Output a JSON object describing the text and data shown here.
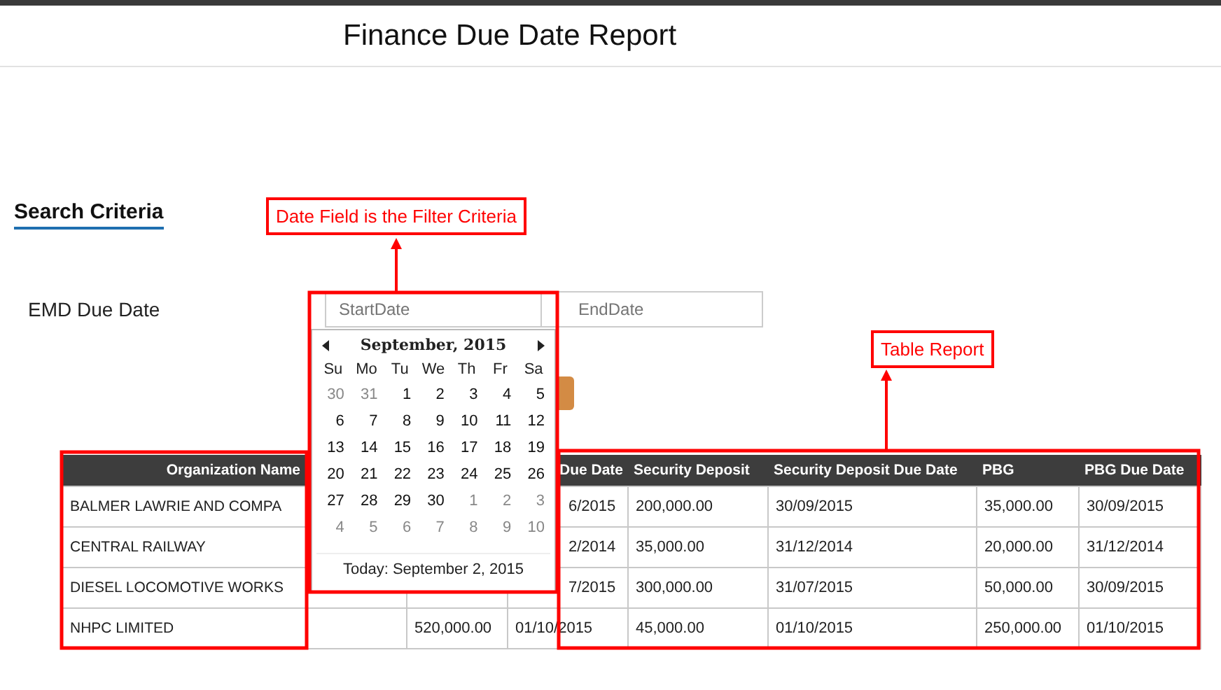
{
  "page": {
    "title": "Finance Due Date Report"
  },
  "search_criteria": {
    "heading": "Search Criteria",
    "field_label": "EMD Due Date",
    "start": {
      "placeholder": "StartDate"
    },
    "end": {
      "placeholder": "EndDate"
    }
  },
  "date_picker": {
    "month": "September, 2015",
    "weekdays": [
      "Su",
      "Mo",
      "Tu",
      "We",
      "Th",
      "Fr",
      "Sa"
    ],
    "weeks": [
      [
        {
          "day": "30",
          "other_month": true
        },
        {
          "day": "31",
          "other_month": true
        },
        {
          "day": "1",
          "other_month": false
        },
        {
          "day": "2",
          "other_month": false
        },
        {
          "day": "3",
          "other_month": false
        },
        {
          "day": "4",
          "other_month": false
        },
        {
          "day": "5",
          "other_month": false
        }
      ],
      [
        {
          "day": "6",
          "other_month": false
        },
        {
          "day": "7",
          "other_month": false
        },
        {
          "day": "8",
          "other_month": false
        },
        {
          "day": "9",
          "other_month": false
        },
        {
          "day": "10",
          "other_month": false
        },
        {
          "day": "11",
          "other_month": false
        },
        {
          "day": "12",
          "other_month": false
        }
      ],
      [
        {
          "day": "13",
          "other_month": false
        },
        {
          "day": "14",
          "other_month": false
        },
        {
          "day": "15",
          "other_month": false
        },
        {
          "day": "16",
          "other_month": false
        },
        {
          "day": "17",
          "other_month": false
        },
        {
          "day": "18",
          "other_month": false
        },
        {
          "day": "19",
          "other_month": false
        }
      ],
      [
        {
          "day": "20",
          "other_month": false
        },
        {
          "day": "21",
          "other_month": false
        },
        {
          "day": "22",
          "other_month": false
        },
        {
          "day": "23",
          "other_month": false
        },
        {
          "day": "24",
          "other_month": false
        },
        {
          "day": "25",
          "other_month": false
        },
        {
          "day": "26",
          "other_month": false
        }
      ],
      [
        {
          "day": "27",
          "other_month": false
        },
        {
          "day": "28",
          "other_month": false
        },
        {
          "day": "29",
          "other_month": false
        },
        {
          "day": "30",
          "other_month": false
        },
        {
          "day": "1",
          "other_month": true
        },
        {
          "day": "2",
          "other_month": true
        },
        {
          "day": "3",
          "other_month": true
        }
      ],
      [
        {
          "day": "4",
          "other_month": true
        },
        {
          "day": "5",
          "other_month": true
        },
        {
          "day": "6",
          "other_month": true
        },
        {
          "day": "7",
          "other_month": true
        },
        {
          "day": "8",
          "other_month": true
        },
        {
          "day": "9",
          "other_month": true
        },
        {
          "day": "10",
          "other_month": true
        }
      ]
    ],
    "today": "Today: September 2, 2015"
  },
  "table": {
    "columns": [
      "Organization Name",
      null,
      "Due Date",
      "Security Deposit",
      "Security Deposit Due Date",
      "PBG",
      "PBG Due Date"
    ],
    "rows": [
      [
        "BALMER LAWRIE AND COMPA",
        null,
        "6/2015",
        "200,000.00",
        "30/09/2015",
        "35,000.00",
        "30/09/2015"
      ],
      [
        "CENTRAL RAILWAY",
        null,
        "2/2014",
        "35,000.00",
        "31/12/2014",
        "20,000.00",
        "31/12/2014"
      ],
      [
        "DIESEL LOCOMOTIVE WORKS",
        null,
        "7/2015",
        "300,000.00",
        "31/07/2015",
        "50,000.00",
        "30/09/2015"
      ],
      [
        "NHPC LIMITED",
        "520,000.00",
        "01/10/2015",
        "45,000.00",
        "01/10/2015",
        "250,000.00",
        "01/10/2015"
      ]
    ]
  },
  "annotations": [
    "Date Field is the Filter Criteria",
    "Table Report"
  ]
}
